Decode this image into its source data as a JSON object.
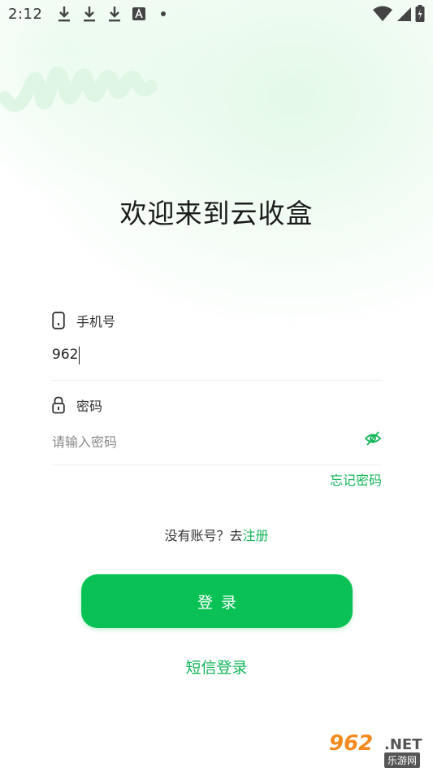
{
  "status_bar": {
    "time": "2:12",
    "icons": [
      "download-icon",
      "download-icon",
      "download-icon",
      "a-icon",
      "dot-icon",
      "wifi-icon",
      "signal-icon",
      "battery-icon"
    ]
  },
  "title": "欢迎来到云收盒",
  "phone": {
    "label": "手机号",
    "value": "962",
    "icon": "phone-icon"
  },
  "password": {
    "label": "密码",
    "placeholder": "请输入密码",
    "icon": "lock-icon",
    "toggle_icon": "eye-off-icon"
  },
  "forgot_password": "忘记密码",
  "register": {
    "prefix": "没有账号？去",
    "link": "注册"
  },
  "login_button": "登录",
  "sms_login": "短信登录",
  "watermark": {
    "main": "962",
    "net": ".NET",
    "sub": "乐游网"
  },
  "colors": {
    "accent": "#0ac155",
    "link": "#13b559"
  }
}
